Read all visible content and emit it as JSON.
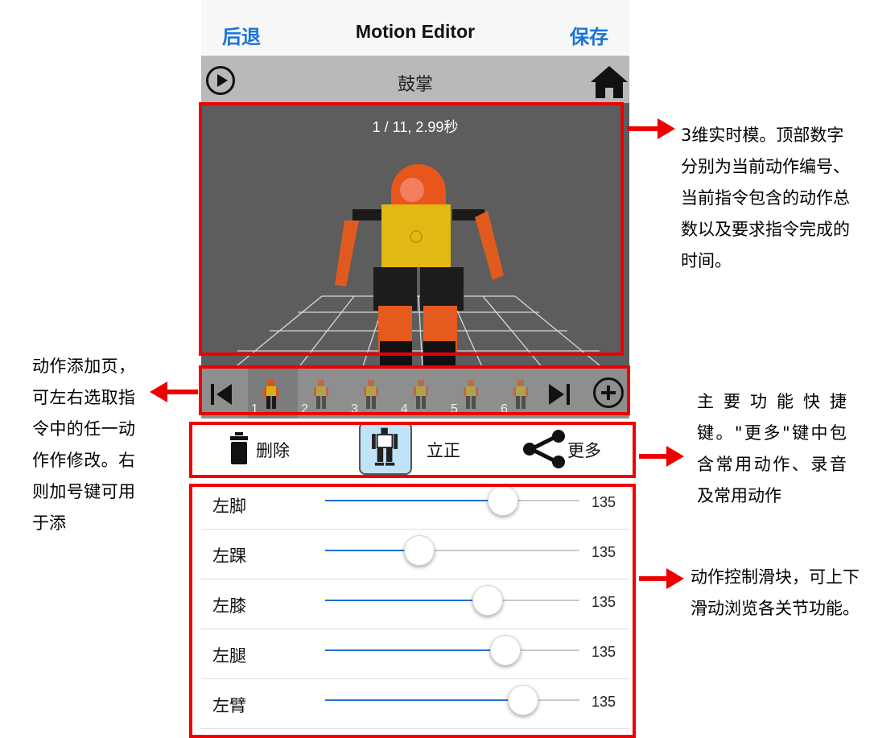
{
  "navbar": {
    "back_label": "后退",
    "title": "Motion Editor",
    "save_label": "保存"
  },
  "subbar": {
    "motion_name": "鼓掌"
  },
  "viewport": {
    "frame_info": "1 / 11, 2.99秒"
  },
  "thumbnails": {
    "numbers": [
      "1",
      "2",
      "3",
      "4",
      "5",
      "6"
    ]
  },
  "toolbar": {
    "delete_label": "删除",
    "stand_label": "立正",
    "more_label": "更多"
  },
  "sliders": [
    {
      "label": "左脚",
      "value": "135",
      "level": 0.7
    },
    {
      "label": "左踝",
      "value": "135",
      "level": 0.37
    },
    {
      "label": "左膝",
      "value": "135",
      "level": 0.64
    },
    {
      "label": "左腿",
      "value": "135",
      "level": 0.71
    },
    {
      "label": "左臂",
      "value": "135",
      "level": 0.78
    }
  ],
  "annotations": {
    "viewport_note": "3维实时模。顶部数字分别为当前动作编号、当前指令包含的动作总数以及要求指令完成的时间。",
    "thumbs_note": "动作添加页，可左右选取指令中的任一动作作修改。右则加号键可用于添",
    "toolbar_note": "主要功能快捷键。\"更多\"键中包含常用动作、录音及常用动作",
    "sliders_note": "动作控制滑块，可上下滑动浏览各关节功能。"
  },
  "colors": {
    "accent": "#1a73d8",
    "annotation": "#ee0000",
    "slider_fill": "#1f6fd1",
    "viewport_bg": "#5d5d5d"
  }
}
